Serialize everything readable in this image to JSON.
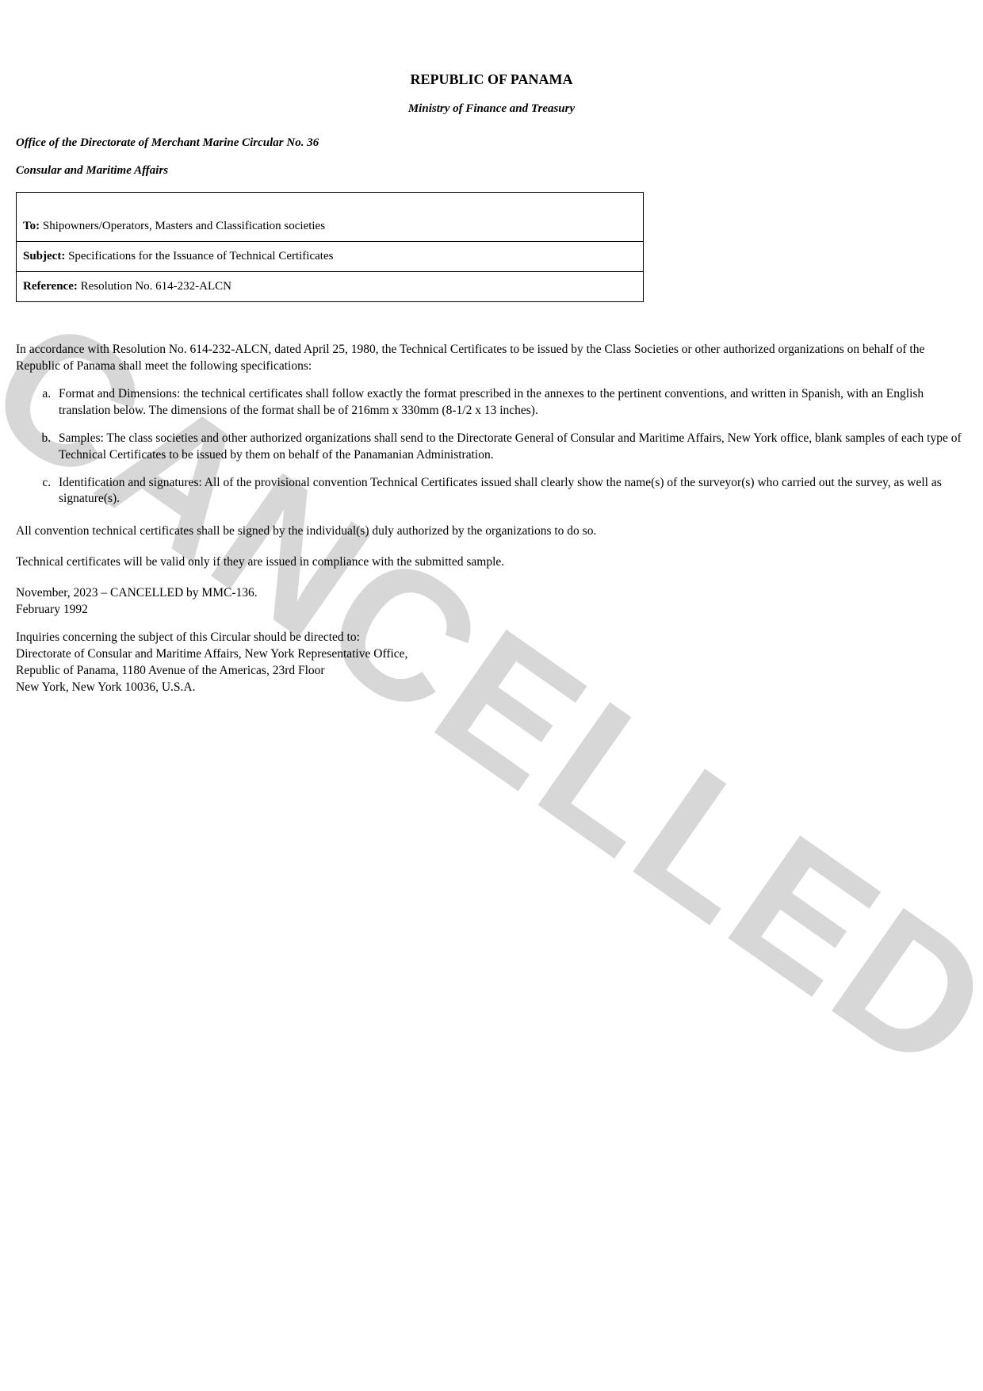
{
  "watermark": "CANCELLED",
  "title": "REPUBLIC OF PANAMA",
  "subtitle": "Ministry of Finance and Treasury",
  "office_line": "Office of the Directorate of Merchant Marine Circular No. 36",
  "affairs_line": "Consular and Maritime Affairs",
  "header": {
    "to_label": "To:",
    "to_value": " Shipowners/Operators, Masters and Classification societies",
    "subject_label": "Subject:",
    "subject_value": " Specifications for the Issuance of Technical Certificates",
    "reference_label": "Reference:",
    "reference_value": " Resolution No. 614-232-ALCN"
  },
  "intro": "In accordance with Resolution No. 614-232-ALCN, dated April 25, 1980, the Technical Certificates to be issued by the Class Societies or other authorized organizations on behalf of the Republic of Panama shall meet the following specifications:",
  "items": {
    "a": "Format and Dimensions: the technical certificates shall follow exactly the format prescribed in the annexes to the pertinent conventions, and written in Spanish, with an English translation below. The dimensions of the format shall be of 216mm x 330mm (8-1/2 x 13 inches).",
    "b": "Samples: The class societies and other authorized organizations shall send to the Directorate General of Consular and Maritime Affairs, New York office, blank samples of each type of Technical Certificates to be issued by them on behalf of the Panamanian Administration.",
    "c": "Identification and signatures: All of the provisional convention Technical Certificates issued shall clearly show the name(s) of the surveyor(s) who carried out the survey, as well as signature(s)."
  },
  "para_signed": "All convention technical certificates shall be signed by the individual(s) duly authorized by the organizations to do so.",
  "para_valid": "Technical certificates will be valid only if they are issued in compliance with the submitted sample.",
  "dates": {
    "cancelled": "November, 2023 – CANCELLED by MMC-136.",
    "issued": "February 1992"
  },
  "inquiries": {
    "l1": "Inquiries concerning the subject of this Circular should be directed to:",
    "l2": "Directorate of Consular and Maritime Affairs, New York Representative Office,",
    "l3": "Republic of Panama, 1180 Avenue of the Americas, 23rd Floor",
    "l4": "New York, New York 10036, U.S.A."
  }
}
